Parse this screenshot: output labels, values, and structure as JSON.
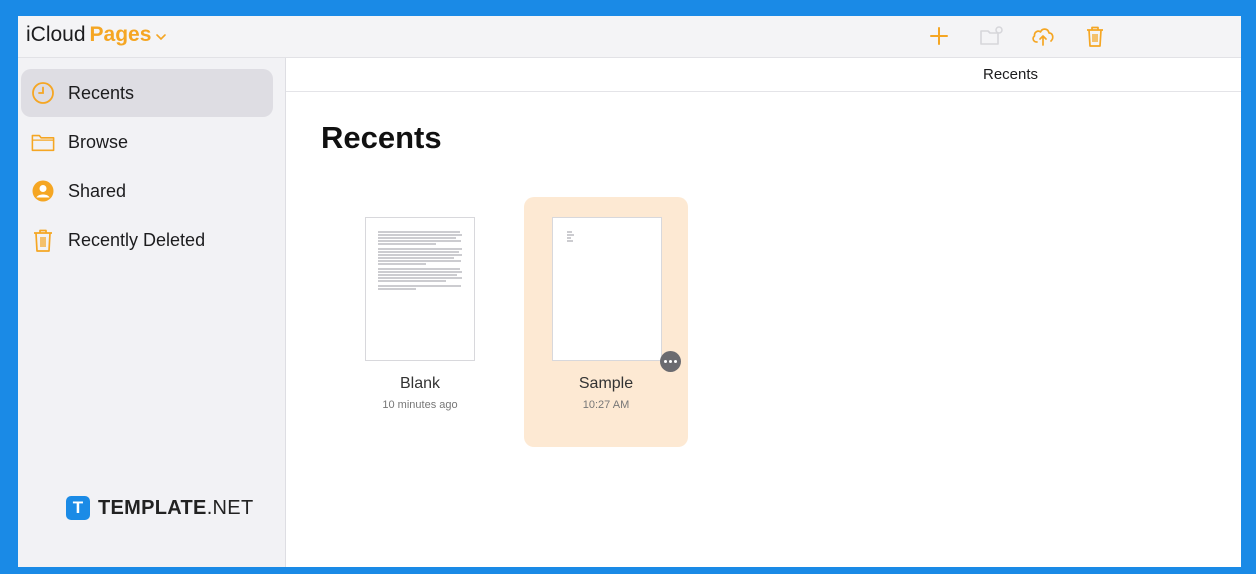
{
  "app": {
    "brand_prefix": "iCloud",
    "brand_product": "Pages",
    "accent_color": "#f5a623",
    "border_color": "#1a8ae6"
  },
  "toolbar": {
    "buttons": [
      {
        "icon": "plus-icon",
        "enabled": true
      },
      {
        "icon": "new-folder-icon",
        "enabled": false
      },
      {
        "icon": "cloud-upload-icon",
        "enabled": true
      },
      {
        "icon": "trash-icon",
        "enabled": true
      }
    ]
  },
  "sidebar": {
    "items": [
      {
        "label": "Recents",
        "icon": "clock-icon",
        "active": true
      },
      {
        "label": "Browse",
        "icon": "folder-icon",
        "active": false
      },
      {
        "label": "Shared",
        "icon": "person-circle-icon",
        "active": false
      },
      {
        "label": "Recently Deleted",
        "icon": "trash-icon",
        "active": false
      }
    ]
  },
  "watermark": {
    "mark": "T",
    "text_bold": "TEMPLATE",
    "text_regular": ".NET"
  },
  "main": {
    "nav_title": "Recents",
    "heading": "Recents",
    "documents": [
      {
        "name": "Blank",
        "time": "10 minutes ago",
        "selected": false
      },
      {
        "name": "Sample",
        "time": "10:27 AM",
        "selected": true
      }
    ]
  }
}
